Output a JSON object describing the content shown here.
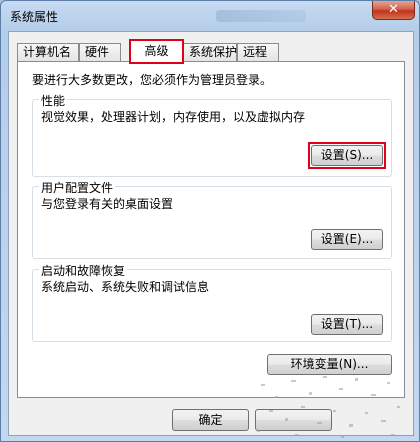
{
  "window": {
    "title": "系统属性",
    "close_glyph": "✕"
  },
  "tabs": [
    {
      "label": "计算机名",
      "active": false
    },
    {
      "label": "硬件",
      "active": false
    },
    {
      "label": "高级",
      "active": true
    },
    {
      "label": "系统保护",
      "active": false
    },
    {
      "label": "远程",
      "active": false
    }
  ],
  "advanced": {
    "notice": "要进行大多数更改，您必须作为管理员登录。",
    "performance": {
      "title": "性能",
      "description": "视觉效果，处理器计划，内存使用，以及虚拟内存",
      "button": "设置(S)..."
    },
    "user_profiles": {
      "title": "用户配置文件",
      "description": "与您登录有关的桌面设置",
      "button": "设置(E)..."
    },
    "startup_recovery": {
      "title": "启动和故障恢复",
      "description": "系统启动、系统失败和调试信息",
      "button": "设置(T)..."
    },
    "env_button": "环境变量(N)..."
  },
  "footer": {
    "ok_button": "确定"
  },
  "colors": {
    "highlight": "#e0001b",
    "close": "#c2331a"
  }
}
